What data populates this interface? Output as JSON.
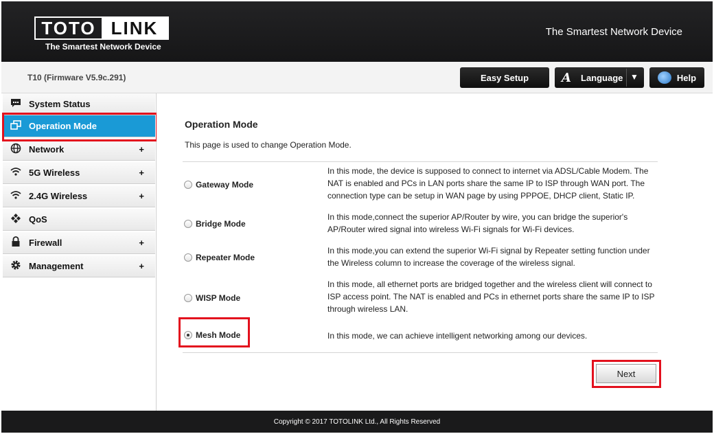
{
  "header": {
    "logo_left": "TOTO",
    "logo_right": "LINK",
    "logo_tagline": "The Smartest Network Device",
    "slogan": "The Smartest Network Device"
  },
  "toolbar": {
    "firmware": "T10 (Firmware V5.9c.291)",
    "easy_setup": "Easy Setup",
    "language": "Language",
    "help": "Help"
  },
  "sidebar": {
    "items": [
      {
        "label": "System Status",
        "icon": "chat-bubble-icon",
        "expandable": false,
        "active": false
      },
      {
        "label": "Operation Mode",
        "icon": "windows-icon",
        "expandable": false,
        "active": true
      },
      {
        "label": "Network",
        "icon": "globe-icon",
        "expandable": true,
        "active": false
      },
      {
        "label": "5G Wireless",
        "icon": "wifi-icon",
        "expandable": true,
        "active": false
      },
      {
        "label": "2.4G Wireless",
        "icon": "wifi-icon",
        "expandable": true,
        "active": false
      },
      {
        "label": "QoS",
        "icon": "arrows-icon",
        "expandable": false,
        "active": false
      },
      {
        "label": "Firewall",
        "icon": "lock-icon",
        "expandable": true,
        "active": false
      },
      {
        "label": "Management",
        "icon": "gear-icon",
        "expandable": true,
        "active": false
      }
    ],
    "plus": "+"
  },
  "main": {
    "title": "Operation Mode",
    "description": "This page is used to change Operation Mode.",
    "modes": [
      {
        "label": "Gateway Mode",
        "checked": false,
        "desc_lines": [
          "In this mode, the device is supposed to connect to internet via ADSL/Cable Modem. The",
          "NAT is enabled and PCs in LAN ports share the same IP to ISP through WAN port. The",
          "connection type can be setup in WAN page by using PPPOE, DHCP client, Static IP."
        ]
      },
      {
        "label": "Bridge Mode",
        "checked": false,
        "desc_lines": [
          "In this mode,connect the superior AP/Router by wire, you can bridge the superior's",
          "AP/Router wired signal into wireless Wi-Fi signals for Wi-Fi devices."
        ]
      },
      {
        "label": "Repeater Mode",
        "checked": false,
        "desc_lines": [
          "In this mode,you can extend the superior Wi-Fi signal by Repeater setting function under",
          "the Wireless column to increase the coverage of the wireless signal."
        ]
      },
      {
        "label": "WISP Mode",
        "checked": false,
        "desc_lines": [
          "In this mode, all ethernet ports are bridged together and the wireless client will connect to",
          "ISP access point. The NAT is enabled and PCs in ethernet ports share the same IP to ISP",
          "through wireless LAN."
        ]
      },
      {
        "label": "Mesh Mode",
        "checked": true,
        "desc_lines": [
          "In this mode, we can achieve intelligent networking among our devices."
        ]
      }
    ],
    "next": "Next"
  },
  "footer": {
    "copyright": "Copyright © 2017 TOTOLINK Ltd.,   All Rights Reserved"
  },
  "colors": {
    "active_nav": "#1a9ad6",
    "highlight": "#e3101d",
    "header_bg": "#1d1d1f"
  }
}
